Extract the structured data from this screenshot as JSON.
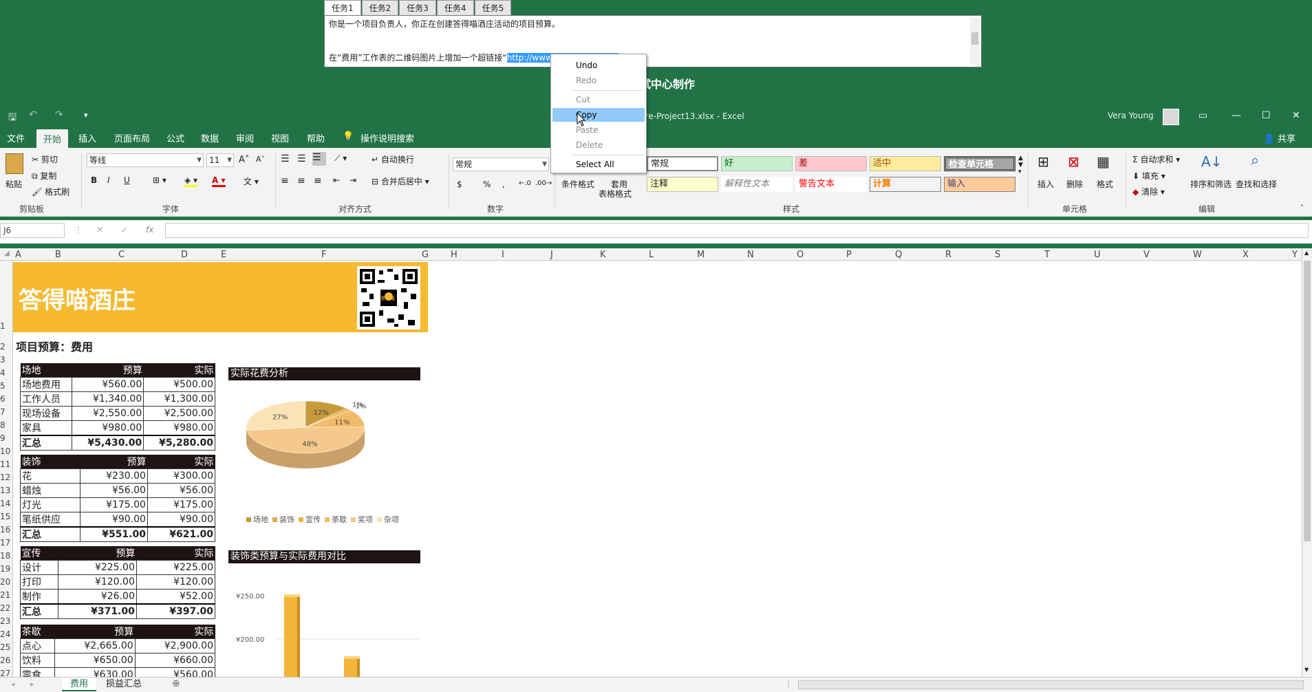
{
  "task_panel": {
    "tabs": [
      "任务1",
      "任务2",
      "任务3",
      "任务4",
      "任务5"
    ],
    "description": "你是一个项目负责人，你正在创建答得喵酒庄活动的项目预算。",
    "instruction_prefix": "在“费用”工作表的二维码图片上增加一个超链接“",
    "instruction_selected": "http://www.dadamiao.com/",
    "instruction_suffix": "”。",
    "center_title": "试中心制作"
  },
  "context_menu": {
    "items": [
      "Undo",
      "Redo",
      "Cut",
      "Copy",
      "Paste",
      "Delete",
      "Select All"
    ]
  },
  "titlebar": {
    "filename": "5-Core-Project13.xlsx  -  Excel",
    "user": "Vera Young",
    "min": "—",
    "restore": "☐",
    "close": "✕"
  },
  "menu": {
    "tabs": [
      "文件",
      "开始",
      "插入",
      "页面布局",
      "公式",
      "数据",
      "审阅",
      "视图",
      "帮助"
    ],
    "tell_me": "操作说明搜索",
    "share": "共享"
  },
  "ribbon": {
    "clipboard": {
      "paste": "粘贴",
      "cut": "剪切",
      "copy": "复制",
      "format_painter": "格式刷",
      "label": "剪贴板"
    },
    "font": {
      "name": "等线",
      "size": "11",
      "label": "字体",
      "bold": "B",
      "italic": "I",
      "underline": "U"
    },
    "alignment": {
      "wrap": "自动换行",
      "merge": "合并后居中",
      "label": "对齐方式"
    },
    "number": {
      "format": "常规",
      "label": "数字",
      "currency": "$",
      "percent": "%",
      "comma": ","
    },
    "styles": {
      "conditional": "条件格式",
      "table_format_1": "套用",
      "table_format_2": "表格格式",
      "label": "样式",
      "cells": [
        "常规",
        "好",
        "差",
        "适中",
        "检查单元格",
        "注释",
        "解释性文本",
        "警告文本",
        "计算",
        "输入"
      ]
    },
    "cells_group": {
      "insert": "插入",
      "delete": "删除",
      "format": "格式",
      "label": "单元格"
    },
    "editing": {
      "autosum": "自动求和",
      "fill": "填充",
      "clear": "清除",
      "sort": "排序和筛选",
      "find": "查找和选择",
      "label": "编辑"
    }
  },
  "formula_bar": {
    "namebox": "J6",
    "fx": "fx"
  },
  "columns": [
    "A",
    "B",
    "C",
    "D",
    "E",
    "F",
    "G",
    "H",
    "I",
    "J",
    "K",
    "L",
    "M",
    "N",
    "O",
    "P",
    "Q",
    "R",
    "S",
    "T",
    "U",
    "V",
    "W",
    "X",
    "Y"
  ],
  "rows": [
    "1",
    "2",
    "3",
    "4",
    "5",
    "6",
    "7",
    "8",
    "9",
    "10",
    "11",
    "12",
    "13",
    "14",
    "15",
    "16",
    "17",
    "18",
    "19",
    "20",
    "21",
    "22",
    "23",
    "24",
    "25",
    "26",
    "27"
  ],
  "sheet": {
    "banner_title": "答得喵酒庄",
    "qr_label": "答得喵",
    "subtitle": "项目预算：费用",
    "tables": [
      {
        "header": [
          "场地",
          "预算",
          "实际"
        ],
        "rows": [
          [
            "场地费用",
            "¥560.00",
            "¥500.00"
          ],
          [
            "工作人员",
            "¥1,340.00",
            "¥1,300.00"
          ],
          [
            "现场设备",
            "¥2,550.00",
            "¥2,500.00"
          ],
          [
            "家具",
            "¥980.00",
            "¥980.00"
          ]
        ],
        "total": [
          "汇总",
          "¥5,430.00",
          "¥5,280.00"
        ]
      },
      {
        "header": [
          "装饰",
          "预算",
          "实际"
        ],
        "rows": [
          [
            "花",
            "¥230.00",
            "¥300.00"
          ],
          [
            "蜡烛",
            "¥56.00",
            "¥56.00"
          ],
          [
            "灯光",
            "¥175.00",
            "¥175.00"
          ],
          [
            "笔纸供应",
            "¥90.00",
            "¥90.00"
          ]
        ],
        "total": [
          "汇总",
          "¥551.00",
          "¥621.00"
        ]
      },
      {
        "header": [
          "宣传",
          "预算",
          "实际"
        ],
        "rows": [
          [
            "设计",
            "¥225.00",
            "¥225.00"
          ],
          [
            "打印",
            "¥120.00",
            "¥120.00"
          ],
          [
            "制作",
            "¥26.00",
            "¥52.00"
          ]
        ],
        "total": [
          "汇总",
          "¥371.00",
          "¥397.00"
        ]
      },
      {
        "header": [
          "茶歇",
          "预算",
          "实际"
        ],
        "rows": [
          [
            "点心",
            "¥2,665.00",
            "¥2,900.00"
          ],
          [
            "饮料",
            "¥650.00",
            "¥660.00"
          ],
          [
            "零食",
            "¥630.00",
            "¥560.00"
          ]
        ]
      }
    ]
  },
  "chart_data": [
    {
      "type": "pie",
      "title": "实际花费分析",
      "categories": [
        "场地",
        "装饰",
        "宣传",
        "茶歇",
        "奖项",
        "杂项"
      ],
      "values": [
        12,
        1,
        1,
        11,
        48,
        27
      ],
      "labels": [
        "12%",
        "1%",
        "1%",
        "11%",
        "48%",
        "27%"
      ],
      "colors": [
        "#c79a3b",
        "#e0a94a",
        "#f0b647",
        "#f2bb6a",
        "#f5c98c",
        "#fbe3b5"
      ]
    },
    {
      "type": "bar",
      "title": "装饰类预算与实际费用对比",
      "yticks": [
        "¥250.00",
        "¥200.00"
      ]
    }
  ],
  "sheet_tabs": [
    "费用",
    "损益汇总"
  ]
}
